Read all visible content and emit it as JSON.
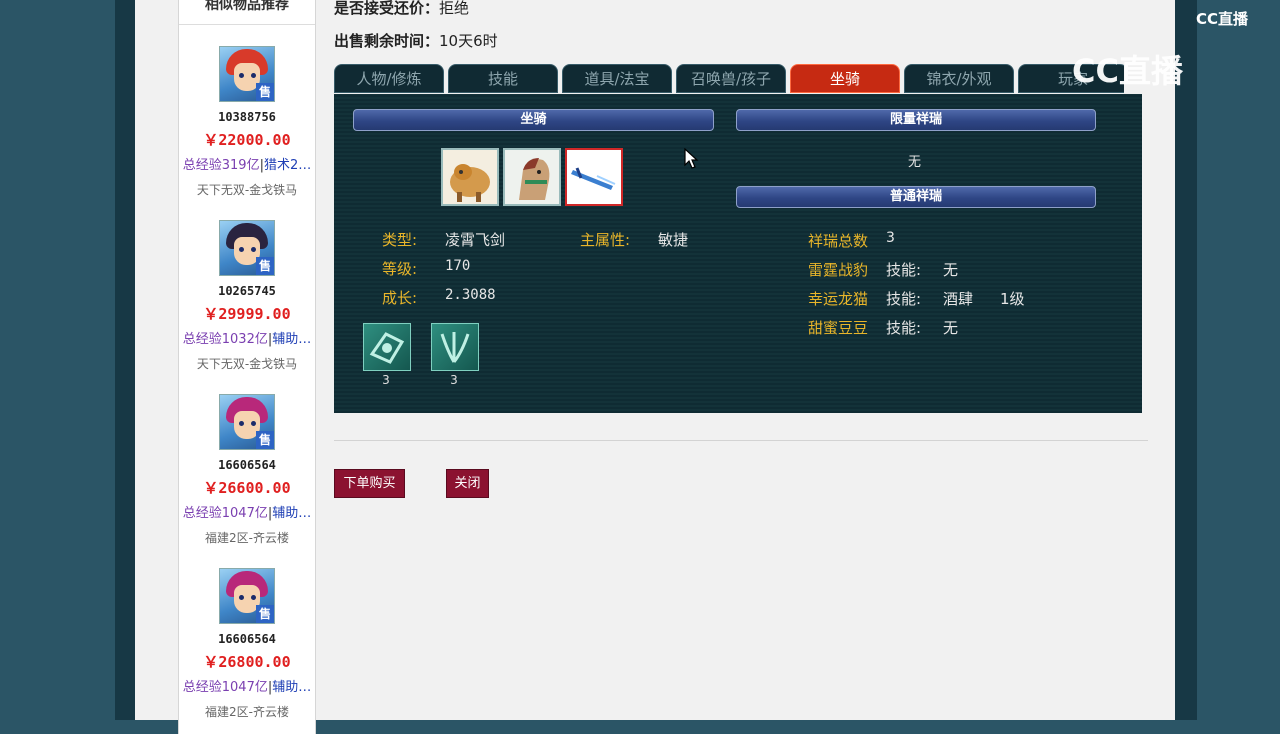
{
  "watermark": {
    "small": "CC直播",
    "big": "CC直播"
  },
  "sidebar": {
    "title": "相似物品推荐",
    "items": [
      {
        "id": "10388756",
        "price": "￥22000.00",
        "exp": "总经验319亿",
        "extra": "猎术2…",
        "server": "天下无双-金戈铁马",
        "tag": "售"
      },
      {
        "id": "10265745",
        "price": "￥29999.00",
        "exp": "总经验1032亿",
        "extra": "辅助…",
        "server": "天下无双-金戈铁马",
        "tag": "售"
      },
      {
        "id": "16606564",
        "price": "￥26600.00",
        "exp": "总经验1047亿",
        "extra": "辅助…",
        "server": "福建2区-齐云楼",
        "tag": "售"
      },
      {
        "id": "16606564",
        "price": "￥26800.00",
        "exp": "总经验1047亿",
        "extra": "辅助…",
        "server": "福建2区-齐云楼",
        "tag": "售"
      }
    ]
  },
  "info": {
    "bargain_label": "是否接受还价：",
    "bargain_value": "拒绝",
    "time_label": "出售剩余时间：",
    "time_value": "10天6时"
  },
  "tabs": [
    "人物/修炼",
    "技能",
    "道具/法宝",
    "召唤兽/孩子",
    "坐骑",
    "锦衣/外观",
    "玩家"
  ],
  "active_tab": "坐骑",
  "mount_panel": {
    "header_left": "坐骑",
    "header_limited": "限量祥瑞",
    "limited_value": "无",
    "header_normal": "普通祥瑞",
    "type_label": "类型:",
    "type_value": "凌霄飞剑",
    "attr_label": "主属性:",
    "attr_value": "敏捷",
    "level_label": "等级:",
    "level_value": "170",
    "growth_label": "成长:",
    "growth_value": "2.3088",
    "skills": [
      {
        "count": "3"
      },
      {
        "count": "3"
      }
    ],
    "xiangrui_total_label": "祥瑞总数",
    "xiangrui_total_value": "3",
    "xiangrui": [
      {
        "name": "雷霆战豹",
        "skill_label": "技能:",
        "skill": "无",
        "level": ""
      },
      {
        "name": "幸运龙猫",
        "skill_label": "技能:",
        "skill": "酒肆",
        "level": "1级"
      },
      {
        "name": "甜蜜豆豆",
        "skill_label": "技能:",
        "skill": "无",
        "level": ""
      }
    ]
  },
  "buttons": {
    "buy": "下单购买",
    "close": "关闭"
  },
  "colors": {
    "active_tab": "#c62a12",
    "price": "#e02020",
    "button": "#8b1230",
    "gold_label": "#e8b52a"
  }
}
